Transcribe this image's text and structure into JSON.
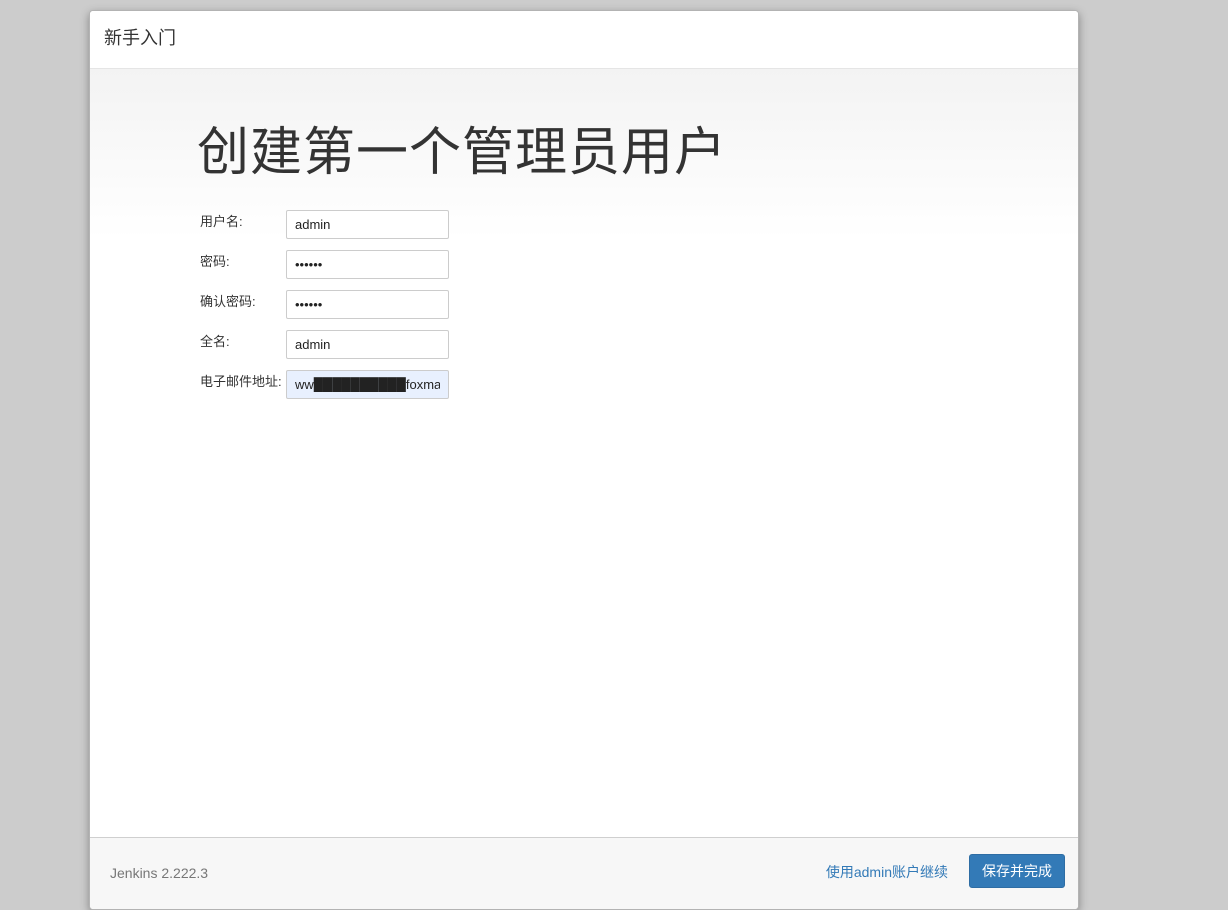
{
  "header": {
    "title": "新手入门"
  },
  "main": {
    "heading": "创建第一个管理员用户",
    "fields": [
      {
        "label": "用户名:",
        "value": "admin",
        "type": "text"
      },
      {
        "label": "密码:",
        "value": "123456",
        "type": "password"
      },
      {
        "label": "确认密码:",
        "value": "123456",
        "type": "password"
      },
      {
        "label": "全名:",
        "value": "admin",
        "type": "text"
      },
      {
        "label": "电子邮件地址:",
        "value": "ww██████████foxma",
        "type": "text"
      }
    ]
  },
  "footer": {
    "version": "Jenkins 2.222.3",
    "continue_link": "使用admin账户继续",
    "save_button": "保存并完成"
  },
  "colors": {
    "primary": "#337ab7",
    "page_background": "#cccccc"
  }
}
